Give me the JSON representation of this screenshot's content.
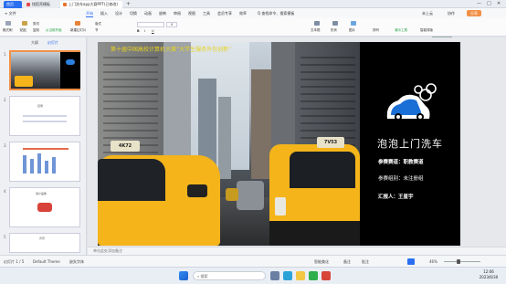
{
  "titlebar": {
    "tabs": [
      {
        "label": "首页"
      },
      {
        "label": "找稻壳模板"
      },
      {
        "label": "上门洗车app大赛PPT(已修改)"
      }
    ],
    "plus": "+",
    "minimize": "—",
    "maximize": "□",
    "close": "✕"
  },
  "menu": {
    "items": [
      "≡ 文件",
      "开始",
      "插入",
      "设计",
      "切换",
      "动画",
      "放映",
      "审阅",
      "视图",
      "工具",
      "会员专享",
      "效率",
      "Q 查找命令、搜索模板"
    ],
    "active_index": 1,
    "right_items": [
      "未上云",
      "协作",
      "分享"
    ],
    "share_label": "分享"
  },
  "ribbon": {
    "left": [
      "格式刷",
      "粘贴",
      "剪切",
      "复制"
    ],
    "slide": [
      "当前开始",
      "新建幻灯片",
      "版式",
      "节"
    ],
    "font_size": "0",
    "right": [
      "文本框",
      "形状",
      "图片",
      "排列",
      "智能排版"
    ],
    "green_left": "从当前开始",
    "green_right": "演示工具"
  },
  "left_panel": {
    "tabs": [
      "大纲",
      "幻灯片"
    ],
    "slide_numbers": [
      "1",
      "2",
      "3",
      "4",
      "5"
    ],
    "thumb_texts": [
      "",
      "目录",
      "",
      "用户画像",
      "背景"
    ]
  },
  "slide": {
    "banner": "第十届中国高校计算机大赛“大学生服务外包创新”",
    "title": "泡泡上门洗车",
    "lines": [
      "参赛赛道：职教赛道",
      "参赛组别：未注册组",
      "汇报人：王星宇"
    ],
    "taxi_sign_left": "4K72",
    "taxi_sign_right": "7V53",
    "restore_label": "还原"
  },
  "notes": {
    "placeholder": "单击此处添加备注"
  },
  "status": {
    "slide_count": "幻灯片 1 / 5",
    "theme": "Default Theme",
    "font_missing": "缺失字体",
    "smart_beautify": "智能美化",
    "notes_label": "备注",
    "comments_label": "批注",
    "zoom": "46%"
  },
  "taskbar": {
    "search_placeholder": "搜索",
    "time": "12:06",
    "date": "2023/6/30"
  },
  "colors": {
    "accent": "#2b6ff0",
    "share": "#f29046",
    "taxi": "#f4b41a"
  }
}
